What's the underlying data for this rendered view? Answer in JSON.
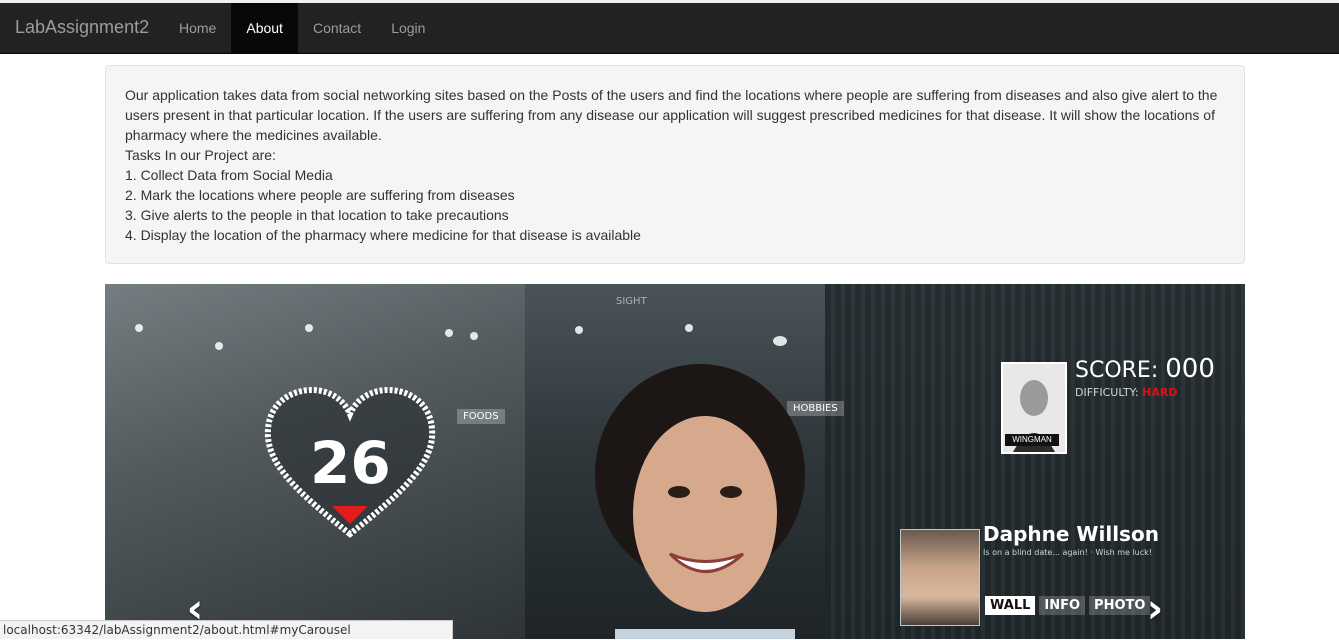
{
  "navbar": {
    "brand": "LabAssignment2",
    "items": [
      {
        "label": "Home",
        "active": false
      },
      {
        "label": "About",
        "active": true
      },
      {
        "label": "Contact",
        "active": false
      },
      {
        "label": "Login",
        "active": false
      }
    ]
  },
  "about": {
    "paragraph": "Our application takes data from social networking sites based on the Posts of the users and find the locations where people are suffering from diseases and also give alert to the users present in that particular location. If the users are suffering from any disease our application will suggest prescribed medicines for that disease. It will show the locations of pharmacy where the medicines available.",
    "tasks_heading": "Tasks In our Project are:",
    "tasks": [
      "1. Collect Data from Social Media",
      "2. Mark the locations where people are suffering from diseases",
      "3. Give alerts to the people in that location to take precautions",
      "4. Display the location of the pharmacy where medicine for that disease is available"
    ]
  },
  "carousel": {
    "heart_value": "26",
    "score_label": "SCORE:",
    "score_value": "000",
    "difficulty_label": "DIFFICULTY:",
    "difficulty_value": "HARD",
    "tag_foods": "FOODS",
    "tag_hobbies": "HOBBIES",
    "tag_sight": "SIGHT",
    "portrait_label": "WINGMAN",
    "profile_name": "Daphne Willson",
    "profile_sub": "Is on a blind date... again! · Wish me luck!",
    "profile_tabs": [
      "WALL",
      "INFO",
      "PHOTO"
    ],
    "prev_icon": "chevron-left-icon",
    "next_icon": "chevron-right-icon"
  },
  "statusbar": {
    "url": "localhost:63342/labAssignment2/about.html#myCarousel"
  }
}
